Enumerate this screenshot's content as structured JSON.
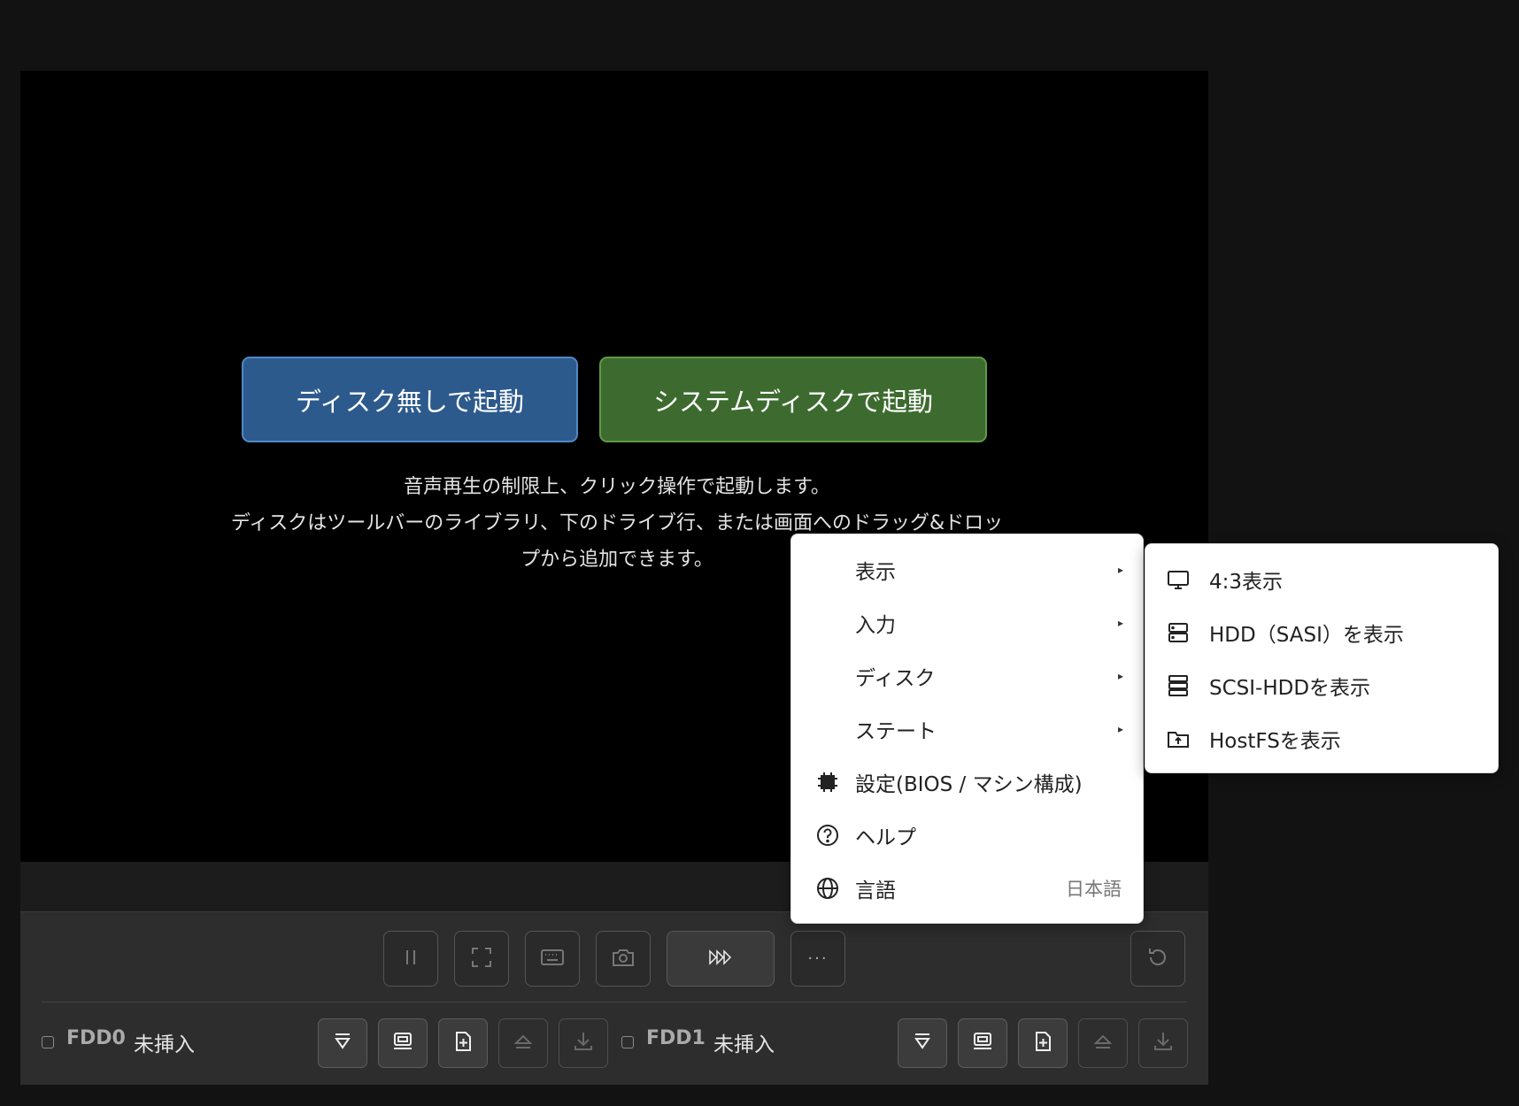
{
  "boot": {
    "no_disk_label": "ディスク無しで起動",
    "system_disk_label": "システムディスクで起動"
  },
  "notice": {
    "line1": "音声再生の制限上、クリック操作で起動します。",
    "line2": "ディスクはツールバーのライブラリ、下のドライブ行、または画面へのドラッグ&ドロッ",
    "line3": "プから追加できます。"
  },
  "main_menu": {
    "items": [
      {
        "label": "表示",
        "has_submenu": true
      },
      {
        "label": "入力",
        "has_submenu": true
      },
      {
        "label": "ディスク",
        "has_submenu": true
      },
      {
        "label": "ステート",
        "has_submenu": true
      },
      {
        "label": "設定(BIOS / マシン構成)",
        "icon": "chip-icon"
      },
      {
        "label": "ヘルプ",
        "icon": "help-circle-icon"
      },
      {
        "label": "言語",
        "icon": "globe-icon",
        "value": "日本語"
      }
    ],
    "submenu_arrow": "▸"
  },
  "sub_menu": {
    "items": [
      {
        "label": "4:3表示",
        "icon": "monitor-icon"
      },
      {
        "label": "HDD（SASI）を表示",
        "icon": "hdd-icon"
      },
      {
        "label": "SCSI-HDDを表示",
        "icon": "server-stack-icon"
      },
      {
        "label": "HostFSを表示",
        "icon": "folder-upload-icon"
      }
    ]
  },
  "toolbar": {
    "more_label": "···",
    "buttons": [
      "pause-icon",
      "fullscreen-icon",
      "keyboard-icon",
      "camera-icon",
      "fast-forward-icon",
      "more-icon",
      "reset-icon"
    ]
  },
  "drives": [
    {
      "name": "FDD0",
      "status": "未挿入"
    },
    {
      "name": "FDD1",
      "status": "未挿入"
    }
  ]
}
